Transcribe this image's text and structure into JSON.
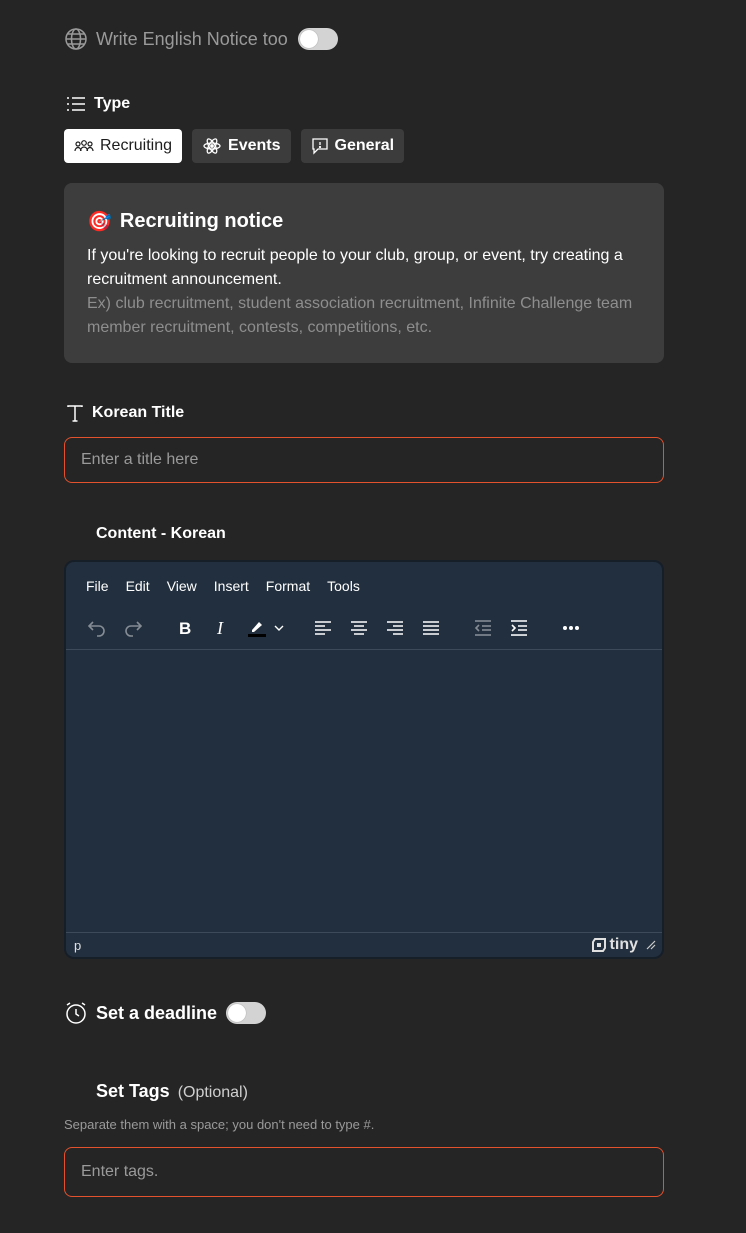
{
  "english_notice": {
    "label": "Write English Notice too",
    "enabled": false
  },
  "type_section": {
    "heading": "Type",
    "options": [
      {
        "label": "Recruiting",
        "icon": "people-icon",
        "selected": true
      },
      {
        "label": "Events",
        "icon": "sparkle-icon",
        "selected": false
      },
      {
        "label": "General",
        "icon": "speech-bubble-icon",
        "selected": false
      }
    ]
  },
  "info_card": {
    "emoji": "🎯",
    "title": "Recruiting notice",
    "description": "If you're looking to recruit people to your club, group, or event, try creating a recruitment announcement.",
    "example": "Ex) club recruitment, student association recruitment, Infinite Challenge team member recruitment, contests, competitions, etc."
  },
  "title_field": {
    "heading": "Korean Title",
    "placeholder": "Enter a title here",
    "value": ""
  },
  "content": {
    "heading": "Content - Korean",
    "menu": [
      "File",
      "Edit",
      "View",
      "Insert",
      "Format",
      "Tools"
    ],
    "status_path": "p",
    "brand": "tiny"
  },
  "deadline": {
    "label": "Set a deadline",
    "enabled": false
  },
  "tags": {
    "heading": "Set Tags",
    "optional": "(Optional)",
    "hint": "Separate them with a space; you don't need to type #.",
    "placeholder": "Enter tags."
  },
  "colors": {
    "accent": "#e4512d",
    "background": "#252525",
    "card": "#3d3d3d",
    "editor": "#222f3e"
  }
}
